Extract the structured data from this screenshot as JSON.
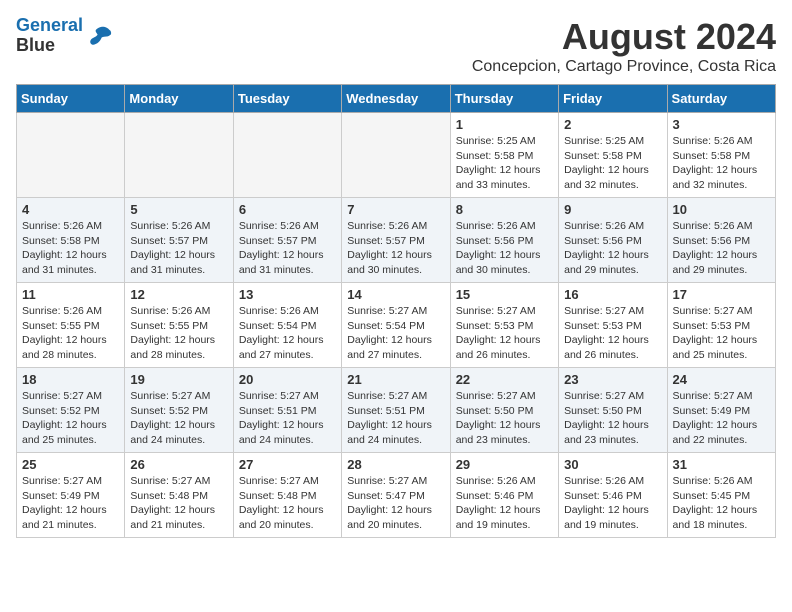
{
  "header": {
    "logo_line1": "General",
    "logo_line2": "Blue",
    "month_year": "August 2024",
    "location": "Concepcion, Cartago Province, Costa Rica"
  },
  "days_of_week": [
    "Sunday",
    "Monday",
    "Tuesday",
    "Wednesday",
    "Thursday",
    "Friday",
    "Saturday"
  ],
  "weeks": [
    [
      {
        "day": "",
        "empty": true
      },
      {
        "day": "",
        "empty": true
      },
      {
        "day": "",
        "empty": true
      },
      {
        "day": "",
        "empty": true
      },
      {
        "day": "1",
        "sunrise": "5:25 AM",
        "sunset": "5:58 PM",
        "daylight": "12 hours and 33 minutes."
      },
      {
        "day": "2",
        "sunrise": "5:25 AM",
        "sunset": "5:58 PM",
        "daylight": "12 hours and 32 minutes."
      },
      {
        "day": "3",
        "sunrise": "5:26 AM",
        "sunset": "5:58 PM",
        "daylight": "12 hours and 32 minutes."
      }
    ],
    [
      {
        "day": "4",
        "sunrise": "5:26 AM",
        "sunset": "5:58 PM",
        "daylight": "12 hours and 31 minutes."
      },
      {
        "day": "5",
        "sunrise": "5:26 AM",
        "sunset": "5:57 PM",
        "daylight": "12 hours and 31 minutes."
      },
      {
        "day": "6",
        "sunrise": "5:26 AM",
        "sunset": "5:57 PM",
        "daylight": "12 hours and 31 minutes."
      },
      {
        "day": "7",
        "sunrise": "5:26 AM",
        "sunset": "5:57 PM",
        "daylight": "12 hours and 30 minutes."
      },
      {
        "day": "8",
        "sunrise": "5:26 AM",
        "sunset": "5:56 PM",
        "daylight": "12 hours and 30 minutes."
      },
      {
        "day": "9",
        "sunrise": "5:26 AM",
        "sunset": "5:56 PM",
        "daylight": "12 hours and 29 minutes."
      },
      {
        "day": "10",
        "sunrise": "5:26 AM",
        "sunset": "5:56 PM",
        "daylight": "12 hours and 29 minutes."
      }
    ],
    [
      {
        "day": "11",
        "sunrise": "5:26 AM",
        "sunset": "5:55 PM",
        "daylight": "12 hours and 28 minutes."
      },
      {
        "day": "12",
        "sunrise": "5:26 AM",
        "sunset": "5:55 PM",
        "daylight": "12 hours and 28 minutes."
      },
      {
        "day": "13",
        "sunrise": "5:26 AM",
        "sunset": "5:54 PM",
        "daylight": "12 hours and 27 minutes."
      },
      {
        "day": "14",
        "sunrise": "5:27 AM",
        "sunset": "5:54 PM",
        "daylight": "12 hours and 27 minutes."
      },
      {
        "day": "15",
        "sunrise": "5:27 AM",
        "sunset": "5:53 PM",
        "daylight": "12 hours and 26 minutes."
      },
      {
        "day": "16",
        "sunrise": "5:27 AM",
        "sunset": "5:53 PM",
        "daylight": "12 hours and 26 minutes."
      },
      {
        "day": "17",
        "sunrise": "5:27 AM",
        "sunset": "5:53 PM",
        "daylight": "12 hours and 25 minutes."
      }
    ],
    [
      {
        "day": "18",
        "sunrise": "5:27 AM",
        "sunset": "5:52 PM",
        "daylight": "12 hours and 25 minutes."
      },
      {
        "day": "19",
        "sunrise": "5:27 AM",
        "sunset": "5:52 PM",
        "daylight": "12 hours and 24 minutes."
      },
      {
        "day": "20",
        "sunrise": "5:27 AM",
        "sunset": "5:51 PM",
        "daylight": "12 hours and 24 minutes."
      },
      {
        "day": "21",
        "sunrise": "5:27 AM",
        "sunset": "5:51 PM",
        "daylight": "12 hours and 24 minutes."
      },
      {
        "day": "22",
        "sunrise": "5:27 AM",
        "sunset": "5:50 PM",
        "daylight": "12 hours and 23 minutes."
      },
      {
        "day": "23",
        "sunrise": "5:27 AM",
        "sunset": "5:50 PM",
        "daylight": "12 hours and 23 minutes."
      },
      {
        "day": "24",
        "sunrise": "5:27 AM",
        "sunset": "5:49 PM",
        "daylight": "12 hours and 22 minutes."
      }
    ],
    [
      {
        "day": "25",
        "sunrise": "5:27 AM",
        "sunset": "5:49 PM",
        "daylight": "12 hours and 21 minutes."
      },
      {
        "day": "26",
        "sunrise": "5:27 AM",
        "sunset": "5:48 PM",
        "daylight": "12 hours and 21 minutes."
      },
      {
        "day": "27",
        "sunrise": "5:27 AM",
        "sunset": "5:48 PM",
        "daylight": "12 hours and 20 minutes."
      },
      {
        "day": "28",
        "sunrise": "5:27 AM",
        "sunset": "5:47 PM",
        "daylight": "12 hours and 20 minutes."
      },
      {
        "day": "29",
        "sunrise": "5:26 AM",
        "sunset": "5:46 PM",
        "daylight": "12 hours and 19 minutes."
      },
      {
        "day": "30",
        "sunrise": "5:26 AM",
        "sunset": "5:46 PM",
        "daylight": "12 hours and 19 minutes."
      },
      {
        "day": "31",
        "sunrise": "5:26 AM",
        "sunset": "5:45 PM",
        "daylight": "12 hours and 18 minutes."
      }
    ]
  ],
  "labels": {
    "sunrise_prefix": "Sunrise:",
    "sunset_prefix": "Sunset:",
    "daylight_prefix": "Daylight:"
  }
}
